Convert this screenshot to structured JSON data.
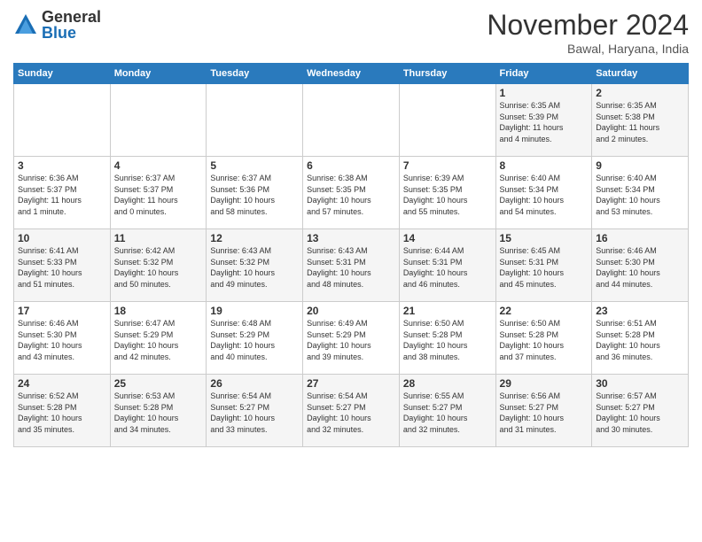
{
  "logo": {
    "general": "General",
    "blue": "Blue"
  },
  "header": {
    "month": "November 2024",
    "location": "Bawal, Haryana, India"
  },
  "weekdays": [
    "Sunday",
    "Monday",
    "Tuesday",
    "Wednesday",
    "Thursday",
    "Friday",
    "Saturday"
  ],
  "weeks": [
    [
      {
        "day": "",
        "info": ""
      },
      {
        "day": "",
        "info": ""
      },
      {
        "day": "",
        "info": ""
      },
      {
        "day": "",
        "info": ""
      },
      {
        "day": "",
        "info": ""
      },
      {
        "day": "1",
        "info": "Sunrise: 6:35 AM\nSunset: 5:39 PM\nDaylight: 11 hours\nand 4 minutes."
      },
      {
        "day": "2",
        "info": "Sunrise: 6:35 AM\nSunset: 5:38 PM\nDaylight: 11 hours\nand 2 minutes."
      }
    ],
    [
      {
        "day": "3",
        "info": "Sunrise: 6:36 AM\nSunset: 5:37 PM\nDaylight: 11 hours\nand 1 minute."
      },
      {
        "day": "4",
        "info": "Sunrise: 6:37 AM\nSunset: 5:37 PM\nDaylight: 11 hours\nand 0 minutes."
      },
      {
        "day": "5",
        "info": "Sunrise: 6:37 AM\nSunset: 5:36 PM\nDaylight: 10 hours\nand 58 minutes."
      },
      {
        "day": "6",
        "info": "Sunrise: 6:38 AM\nSunset: 5:35 PM\nDaylight: 10 hours\nand 57 minutes."
      },
      {
        "day": "7",
        "info": "Sunrise: 6:39 AM\nSunset: 5:35 PM\nDaylight: 10 hours\nand 55 minutes."
      },
      {
        "day": "8",
        "info": "Sunrise: 6:40 AM\nSunset: 5:34 PM\nDaylight: 10 hours\nand 54 minutes."
      },
      {
        "day": "9",
        "info": "Sunrise: 6:40 AM\nSunset: 5:34 PM\nDaylight: 10 hours\nand 53 minutes."
      }
    ],
    [
      {
        "day": "10",
        "info": "Sunrise: 6:41 AM\nSunset: 5:33 PM\nDaylight: 10 hours\nand 51 minutes."
      },
      {
        "day": "11",
        "info": "Sunrise: 6:42 AM\nSunset: 5:32 PM\nDaylight: 10 hours\nand 50 minutes."
      },
      {
        "day": "12",
        "info": "Sunrise: 6:43 AM\nSunset: 5:32 PM\nDaylight: 10 hours\nand 49 minutes."
      },
      {
        "day": "13",
        "info": "Sunrise: 6:43 AM\nSunset: 5:31 PM\nDaylight: 10 hours\nand 48 minutes."
      },
      {
        "day": "14",
        "info": "Sunrise: 6:44 AM\nSunset: 5:31 PM\nDaylight: 10 hours\nand 46 minutes."
      },
      {
        "day": "15",
        "info": "Sunrise: 6:45 AM\nSunset: 5:31 PM\nDaylight: 10 hours\nand 45 minutes."
      },
      {
        "day": "16",
        "info": "Sunrise: 6:46 AM\nSunset: 5:30 PM\nDaylight: 10 hours\nand 44 minutes."
      }
    ],
    [
      {
        "day": "17",
        "info": "Sunrise: 6:46 AM\nSunset: 5:30 PM\nDaylight: 10 hours\nand 43 minutes."
      },
      {
        "day": "18",
        "info": "Sunrise: 6:47 AM\nSunset: 5:29 PM\nDaylight: 10 hours\nand 42 minutes."
      },
      {
        "day": "19",
        "info": "Sunrise: 6:48 AM\nSunset: 5:29 PM\nDaylight: 10 hours\nand 40 minutes."
      },
      {
        "day": "20",
        "info": "Sunrise: 6:49 AM\nSunset: 5:29 PM\nDaylight: 10 hours\nand 39 minutes."
      },
      {
        "day": "21",
        "info": "Sunrise: 6:50 AM\nSunset: 5:28 PM\nDaylight: 10 hours\nand 38 minutes."
      },
      {
        "day": "22",
        "info": "Sunrise: 6:50 AM\nSunset: 5:28 PM\nDaylight: 10 hours\nand 37 minutes."
      },
      {
        "day": "23",
        "info": "Sunrise: 6:51 AM\nSunset: 5:28 PM\nDaylight: 10 hours\nand 36 minutes."
      }
    ],
    [
      {
        "day": "24",
        "info": "Sunrise: 6:52 AM\nSunset: 5:28 PM\nDaylight: 10 hours\nand 35 minutes."
      },
      {
        "day": "25",
        "info": "Sunrise: 6:53 AM\nSunset: 5:28 PM\nDaylight: 10 hours\nand 34 minutes."
      },
      {
        "day": "26",
        "info": "Sunrise: 6:54 AM\nSunset: 5:27 PM\nDaylight: 10 hours\nand 33 minutes."
      },
      {
        "day": "27",
        "info": "Sunrise: 6:54 AM\nSunset: 5:27 PM\nDaylight: 10 hours\nand 32 minutes."
      },
      {
        "day": "28",
        "info": "Sunrise: 6:55 AM\nSunset: 5:27 PM\nDaylight: 10 hours\nand 32 minutes."
      },
      {
        "day": "29",
        "info": "Sunrise: 6:56 AM\nSunset: 5:27 PM\nDaylight: 10 hours\nand 31 minutes."
      },
      {
        "day": "30",
        "info": "Sunrise: 6:57 AM\nSunset: 5:27 PM\nDaylight: 10 hours\nand 30 minutes."
      }
    ]
  ]
}
